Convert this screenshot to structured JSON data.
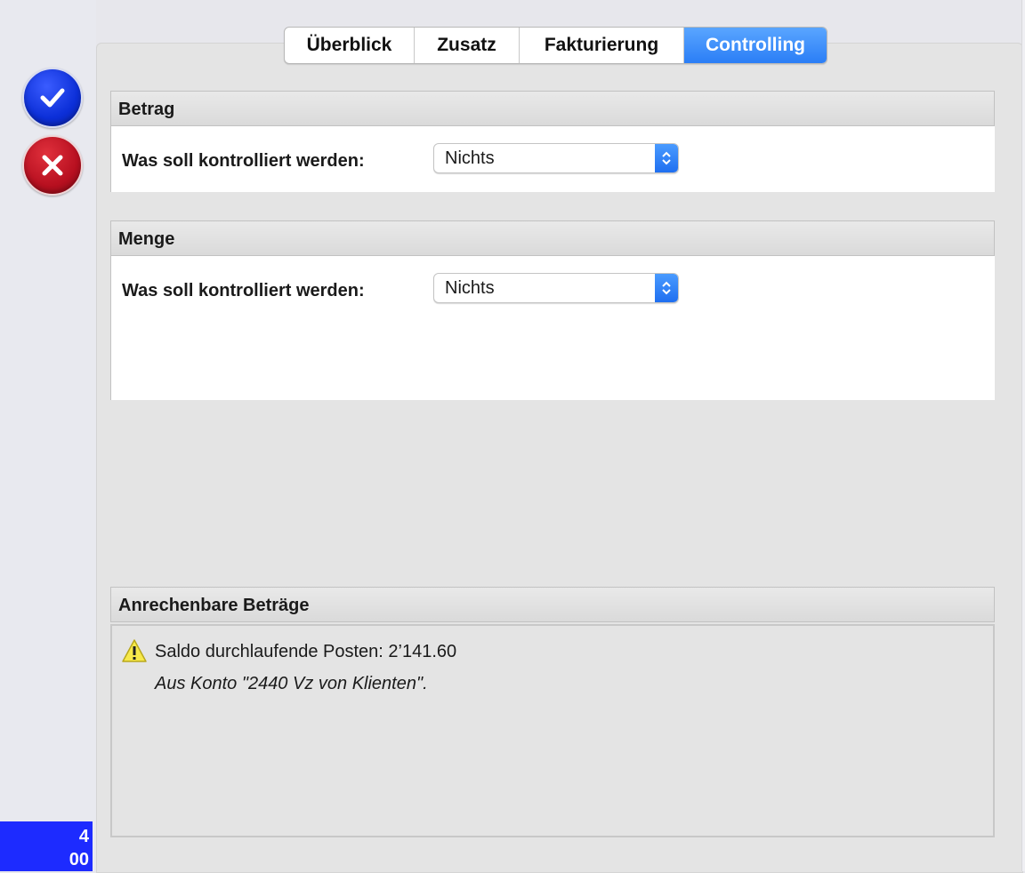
{
  "sidebar": {
    "ok_icon": "checkmark-icon",
    "cancel_icon": "close-icon",
    "badge_line1": "4",
    "badge_line2": "00"
  },
  "tabs": [
    {
      "label": "Überblick",
      "active": false
    },
    {
      "label": "Zusatz",
      "active": false
    },
    {
      "label": "Fakturierung",
      "active": false
    },
    {
      "label": "Controlling",
      "active": true
    }
  ],
  "betrag": {
    "title": "Betrag",
    "field_label": "Was soll kontrolliert werden:",
    "select_value": "Nichts"
  },
  "menge": {
    "title": "Menge",
    "field_label": "Was soll kontrolliert werden:",
    "select_value": "Nichts"
  },
  "anrechenbare": {
    "title": "Anrechenbare Beträge",
    "icon": "warning-icon",
    "line1": "Saldo durchlaufende Posten: 2’141.60",
    "line2": "Aus Konto \"2440 Vz von Klienten\"."
  },
  "colors": {
    "accent": "#2a7ef6",
    "ok": "#0c2fd8",
    "cancel": "#b81020",
    "badge": "#1d2bff"
  }
}
